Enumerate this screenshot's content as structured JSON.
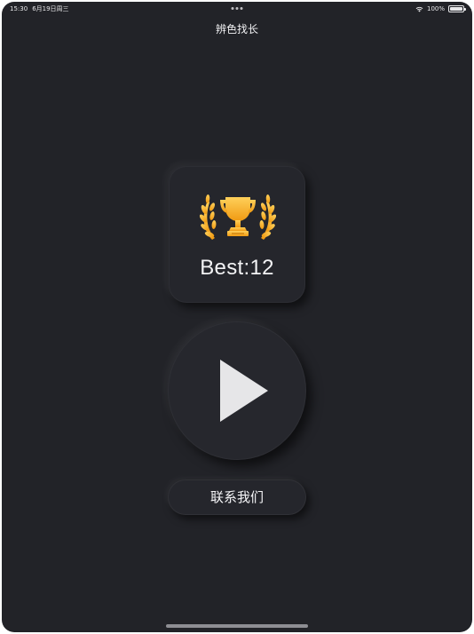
{
  "status_bar": {
    "time": "15:30",
    "date": "6月19日周三",
    "battery": "100%"
  },
  "nav": {
    "title": "辨色找长"
  },
  "best": {
    "text": "Best:12",
    "icon": "trophy-icon"
  },
  "play": {
    "icon": "play-icon"
  },
  "contact": {
    "label": "联系我们"
  },
  "colors": {
    "background": "#222328",
    "card": "#25262c",
    "trophy": "#f5a623",
    "text": "#f3f3f5",
    "play_triangle": "#e6e6e8"
  }
}
